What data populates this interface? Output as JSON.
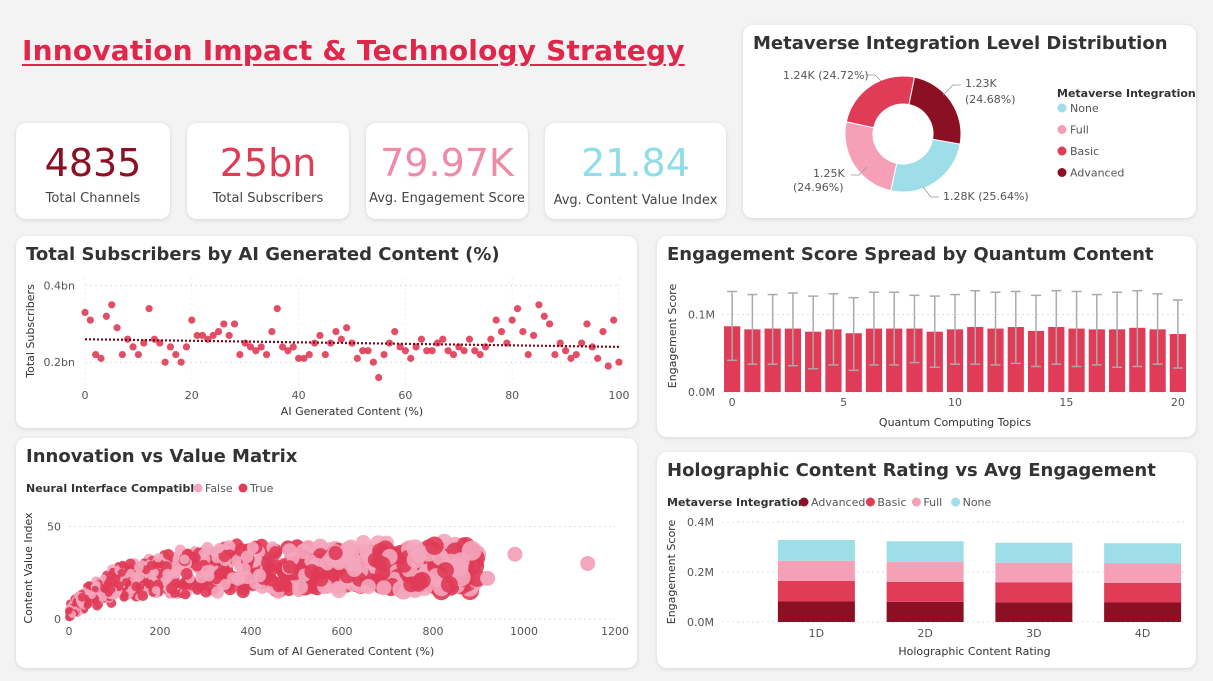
{
  "page": {
    "title": "Innovation Impact & Technology Strategy"
  },
  "colors": {
    "none": "#9edee8",
    "full": "#f5a0b7",
    "basic": "#e03b57",
    "advanced": "#8b1023",
    "red": "#e0264a",
    "false_pink": "#f4a6bd",
    "true_red": "#e03b57",
    "trend": "#7a0a1a"
  },
  "kpis": [
    {
      "value": "4835",
      "label": "Total Channels",
      "color": "#8b1023"
    },
    {
      "value": "25bn",
      "label": "Total Subscribers",
      "color": "#e03b57"
    },
    {
      "value": "79.97K",
      "label": "Avg. Engagement Score",
      "color": "#f08aa6"
    },
    {
      "value": "21.84",
      "label": "Avg. Content Value Index",
      "color": "#8fdde8"
    }
  ],
  "donut": {
    "title": "Metaverse Integration Level Distribution",
    "legend_title": "Metaverse Integration",
    "labels": [
      "1.24K (24.72%)",
      "1.23K",
      "(24.68%)",
      "1.25K",
      "(24.96%)",
      "1.28K (25.64%)"
    ]
  },
  "scatter1": {
    "title": "Total Subscribers by AI Generated Content (%)",
    "xlabel": "AI Generated Content (%)",
    "ylabel": "Total Subscribers",
    "ytick_labels": [
      "0.4bn",
      "0.2bn"
    ]
  },
  "bars1": {
    "title": "Engagement Score Spread by Quantum Content",
    "xlabel": "Quantum Computing Topics",
    "ylabel": "Engagement Score",
    "ytick_labels": [
      "0.1M",
      "0.0M"
    ]
  },
  "matrix": {
    "title": "Innovation vs Value Matrix",
    "legend_title": "Neural Interface Compatible",
    "legend": [
      "False",
      "True"
    ],
    "xlabel": "Sum of AI Generated Content (%)",
    "ylabel": "Content Value Index"
  },
  "stacked": {
    "title": "Holographic Content Rating vs Avg Engagement",
    "legend_title": "Metaverse Integration",
    "legend": [
      "Advanced",
      "Basic",
      "Full",
      "None"
    ],
    "xlabel": "Holographic Content Rating",
    "ylabel": "Engagement Score",
    "ytick_labels": [
      "0.4M",
      "0.2M",
      "0.0M"
    ]
  },
  "chart_data": [
    {
      "type": "pie",
      "title": "Metaverse Integration Level Distribution",
      "categories": [
        "None",
        "Full",
        "Basic",
        "Advanced"
      ],
      "values": [
        1280,
        1250,
        1240,
        1230
      ],
      "percentages": [
        25.64,
        24.96,
        24.72,
        24.68
      ]
    },
    {
      "type": "scatter",
      "title": "Total Subscribers by AI Generated Content (%)",
      "xlabel": "AI Generated Content (%)",
      "ylabel": "Total Subscribers",
      "xlim": [
        0,
        100
      ],
      "ylim": [
        0.13,
        0.42
      ],
      "xticks": [
        0,
        20,
        40,
        60,
        80,
        100
      ],
      "x": [
        0,
        1,
        2,
        3,
        4,
        5,
        6,
        7,
        8,
        9,
        10,
        11,
        12,
        13,
        14,
        15,
        16,
        17,
        18,
        19,
        20,
        21,
        22,
        23,
        24,
        25,
        26,
        27,
        28,
        29,
        30,
        31,
        32,
        33,
        34,
        35,
        36,
        37,
        38,
        39,
        40,
        41,
        42,
        43,
        44,
        45,
        46,
        47,
        48,
        49,
        50,
        51,
        52,
        53,
        54,
        55,
        56,
        57,
        58,
        59,
        60,
        61,
        62,
        63,
        64,
        65,
        66,
        67,
        68,
        69,
        70,
        71,
        72,
        73,
        74,
        75,
        76,
        77,
        78,
        79,
        80,
        81,
        82,
        83,
        84,
        85,
        86,
        87,
        88,
        89,
        90,
        91,
        92,
        93,
        94,
        95,
        96,
        97,
        98,
        99,
        100
      ],
      "y": [
        0.33,
        0.31,
        0.22,
        0.21,
        0.32,
        0.35,
        0.29,
        0.22,
        0.26,
        0.24,
        0.22,
        0.25,
        0.34,
        0.26,
        0.25,
        0.2,
        0.24,
        0.22,
        0.2,
        0.24,
        0.31,
        0.27,
        0.27,
        0.26,
        0.27,
        0.28,
        0.3,
        0.27,
        0.3,
        0.22,
        0.25,
        0.24,
        0.23,
        0.24,
        0.22,
        0.28,
        0.34,
        0.24,
        0.23,
        0.24,
        0.21,
        0.21,
        0.22,
        0.25,
        0.27,
        0.22,
        0.25,
        0.28,
        0.26,
        0.29,
        0.25,
        0.21,
        0.23,
        0.23,
        0.2,
        0.16,
        0.22,
        0.25,
        0.28,
        0.24,
        0.23,
        0.21,
        0.24,
        0.26,
        0.23,
        0.23,
        0.25,
        0.26,
        0.23,
        0.22,
        0.24,
        0.23,
        0.26,
        0.23,
        0.22,
        0.24,
        0.26,
        0.31,
        0.28,
        0.25,
        0.31,
        0.34,
        0.28,
        0.22,
        0.27,
        0.35,
        0.32,
        0.3,
        0.22,
        0.25,
        0.23,
        0.21,
        0.22,
        0.25,
        0.3,
        0.24,
        0.21,
        0.28,
        0.19,
        0.31,
        0.2
      ],
      "trend": {
        "y_at_0": 0.26,
        "y_at_100": 0.24
      }
    },
    {
      "type": "bar",
      "title": "Engagement Score Spread by Quantum Content",
      "xlabel": "Quantum Computing Topics",
      "ylabel": "Engagement Score",
      "xticks": [
        0,
        5,
        10,
        15,
        20
      ],
      "ylim": [
        0,
        0.15
      ],
      "categories": [
        0,
        1,
        2,
        3,
        4,
        5,
        6,
        7,
        8,
        9,
        10,
        11,
        12,
        13,
        14,
        15,
        16,
        17,
        18,
        19,
        20
      ],
      "values": [
        0.085,
        0.081,
        0.082,
        0.082,
        0.078,
        0.081,
        0.076,
        0.082,
        0.082,
        0.082,
        0.078,
        0.081,
        0.084,
        0.082,
        0.084,
        0.079,
        0.084,
        0.082,
        0.081,
        0.081,
        0.083,
        0.081,
        0.075
      ],
      "error_low": [
        0.041,
        0.036,
        0.036,
        0.034,
        0.03,
        0.035,
        0.028,
        0.035,
        0.035,
        0.038,
        0.032,
        0.036,
        0.036,
        0.035,
        0.037,
        0.033,
        0.036,
        0.033,
        0.035,
        0.032,
        0.033,
        0.036,
        0.031
      ],
      "error_high": [
        0.13,
        0.126,
        0.126,
        0.128,
        0.124,
        0.127,
        0.122,
        0.129,
        0.129,
        0.125,
        0.124,
        0.126,
        0.131,
        0.129,
        0.13,
        0.125,
        0.131,
        0.13,
        0.126,
        0.129,
        0.131,
        0.127,
        0.119
      ]
    },
    {
      "type": "scatter",
      "title": "Innovation vs Value Matrix",
      "xlabel": "Sum of AI Generated Content (%)",
      "ylabel": "Content Value Index",
      "xlim": [
        0,
        1200
      ],
      "ylim": [
        0,
        60
      ],
      "xticks": [
        0,
        200,
        400,
        600,
        800,
        1000,
        1200
      ],
      "yticks": [
        0,
        50
      ],
      "legend_title": "Neural Interface Compatible",
      "series_names": [
        "False",
        "True"
      ],
      "note": "Dense cloud of points rising from origin and plateauing near 35-40",
      "outliers": [
        {
          "x": 1140,
          "y": 30,
          "series": "False"
        },
        {
          "x": 920,
          "y": 22,
          "series": "False"
        },
        {
          "x": 980,
          "y": 35,
          "series": "False"
        }
      ]
    },
    {
      "type": "bar",
      "title": "Holographic Content Rating vs Avg Engagement",
      "stacked": true,
      "xlabel": "Holographic Content Rating",
      "ylabel": "Engagement Score",
      "ylim": [
        0,
        0.4
      ],
      "categories": [
        "1D",
        "2D",
        "3D",
        "4D"
      ],
      "series": [
        {
          "name": "Advanced",
          "values": [
            0.082,
            0.081,
            0.079,
            0.078
          ]
        },
        {
          "name": "Basic",
          "values": [
            0.082,
            0.08,
            0.08,
            0.078
          ]
        },
        {
          "name": "Full",
          "values": [
            0.081,
            0.08,
            0.078,
            0.078
          ]
        },
        {
          "name": "None",
          "values": [
            0.083,
            0.082,
            0.08,
            0.081
          ]
        }
      ]
    }
  ]
}
